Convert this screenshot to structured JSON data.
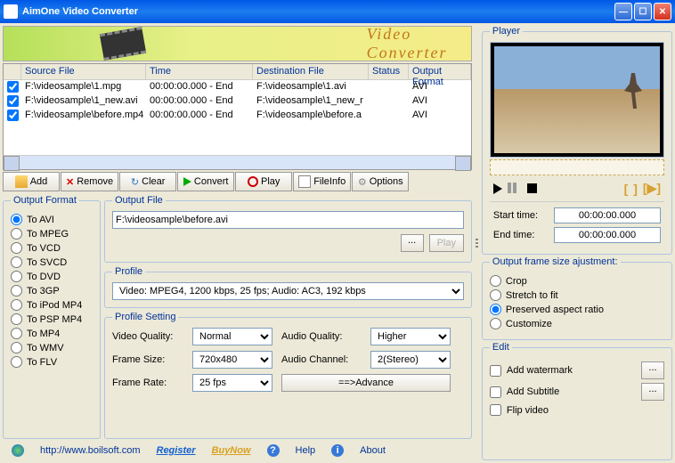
{
  "window": {
    "title": "AimOne Video Converter"
  },
  "banner": {
    "text": "Video Converter"
  },
  "grid": {
    "headers": {
      "source": "Source File",
      "time": "Time",
      "dest": "Destination File",
      "status": "Status",
      "format": "Output Format"
    },
    "rows": [
      {
        "src": "F:\\videosample\\1.mpg",
        "time": "00:00:00.000 - End",
        "dest": "F:\\videosample\\1.avi",
        "status": "",
        "fmt": "AVI"
      },
      {
        "src": "F:\\videosample\\1_new.avi",
        "time": "00:00:00.000 - End",
        "dest": "F:\\videosample\\1_new_r",
        "status": "",
        "fmt": "AVI"
      },
      {
        "src": "F:\\videosample\\before.mp4",
        "time": "00:00:00.000 - End",
        "dest": "F:\\videosample\\before.a",
        "status": "",
        "fmt": "AVI"
      }
    ]
  },
  "toolbar": {
    "add": "Add",
    "remove": "Remove",
    "clear": "Clear",
    "convert": "Convert",
    "play": "Play",
    "fileinfo": "FileInfo",
    "options": "Options"
  },
  "outputFormat": {
    "legend": "Output Format",
    "items": [
      "To AVI",
      "To MPEG",
      "To VCD",
      "To SVCD",
      "To DVD",
      "To 3GP",
      "To iPod MP4",
      "To PSP MP4",
      "To MP4",
      "To WMV",
      "To FLV"
    ],
    "selectedIndex": 0
  },
  "outputFile": {
    "legend": "Output File",
    "value": "F:\\videosample\\before.avi",
    "browse": "...",
    "play": "Play"
  },
  "profile": {
    "legend": "Profile",
    "value": "Video: MPEG4, 1200 kbps, 25 fps;  Audio: AC3, 192 kbps"
  },
  "profileSetting": {
    "legend": "Profile Setting",
    "videoQualityLabel": "Video Quality:",
    "videoQuality": "Normal",
    "frameSizeLabel": "Frame Size:",
    "frameSize": "720x480",
    "frameRateLabel": "Frame Rate:",
    "frameRate": "25 fps",
    "audioQualityLabel": "Audio Quality:",
    "audioQuality": "Higher",
    "audioChannelLabel": "Audio Channel:",
    "audioChannel": "2(Stereo)",
    "advance": "==>Advance"
  },
  "footer": {
    "url": "http://www.boilsoft.com",
    "register": "Register",
    "buynow": "BuyNow",
    "help": "Help",
    "about": "About"
  },
  "player": {
    "legend": "Player",
    "startLabel": "Start time:",
    "startValue": "00:00:00.000",
    "endLabel": "End  time:",
    "endValue": "00:00:00.000"
  },
  "frameAdjust": {
    "legend": "Output frame size ajustment:",
    "items": [
      "Crop",
      "Stretch to fit",
      "Preserved aspect ratio",
      "Customize"
    ],
    "selectedIndex": 2
  },
  "edit": {
    "legend": "Edit",
    "watermark": "Add watermark",
    "subtitle": "Add Subtitle",
    "flip": "Flip video",
    "dots": "..."
  }
}
